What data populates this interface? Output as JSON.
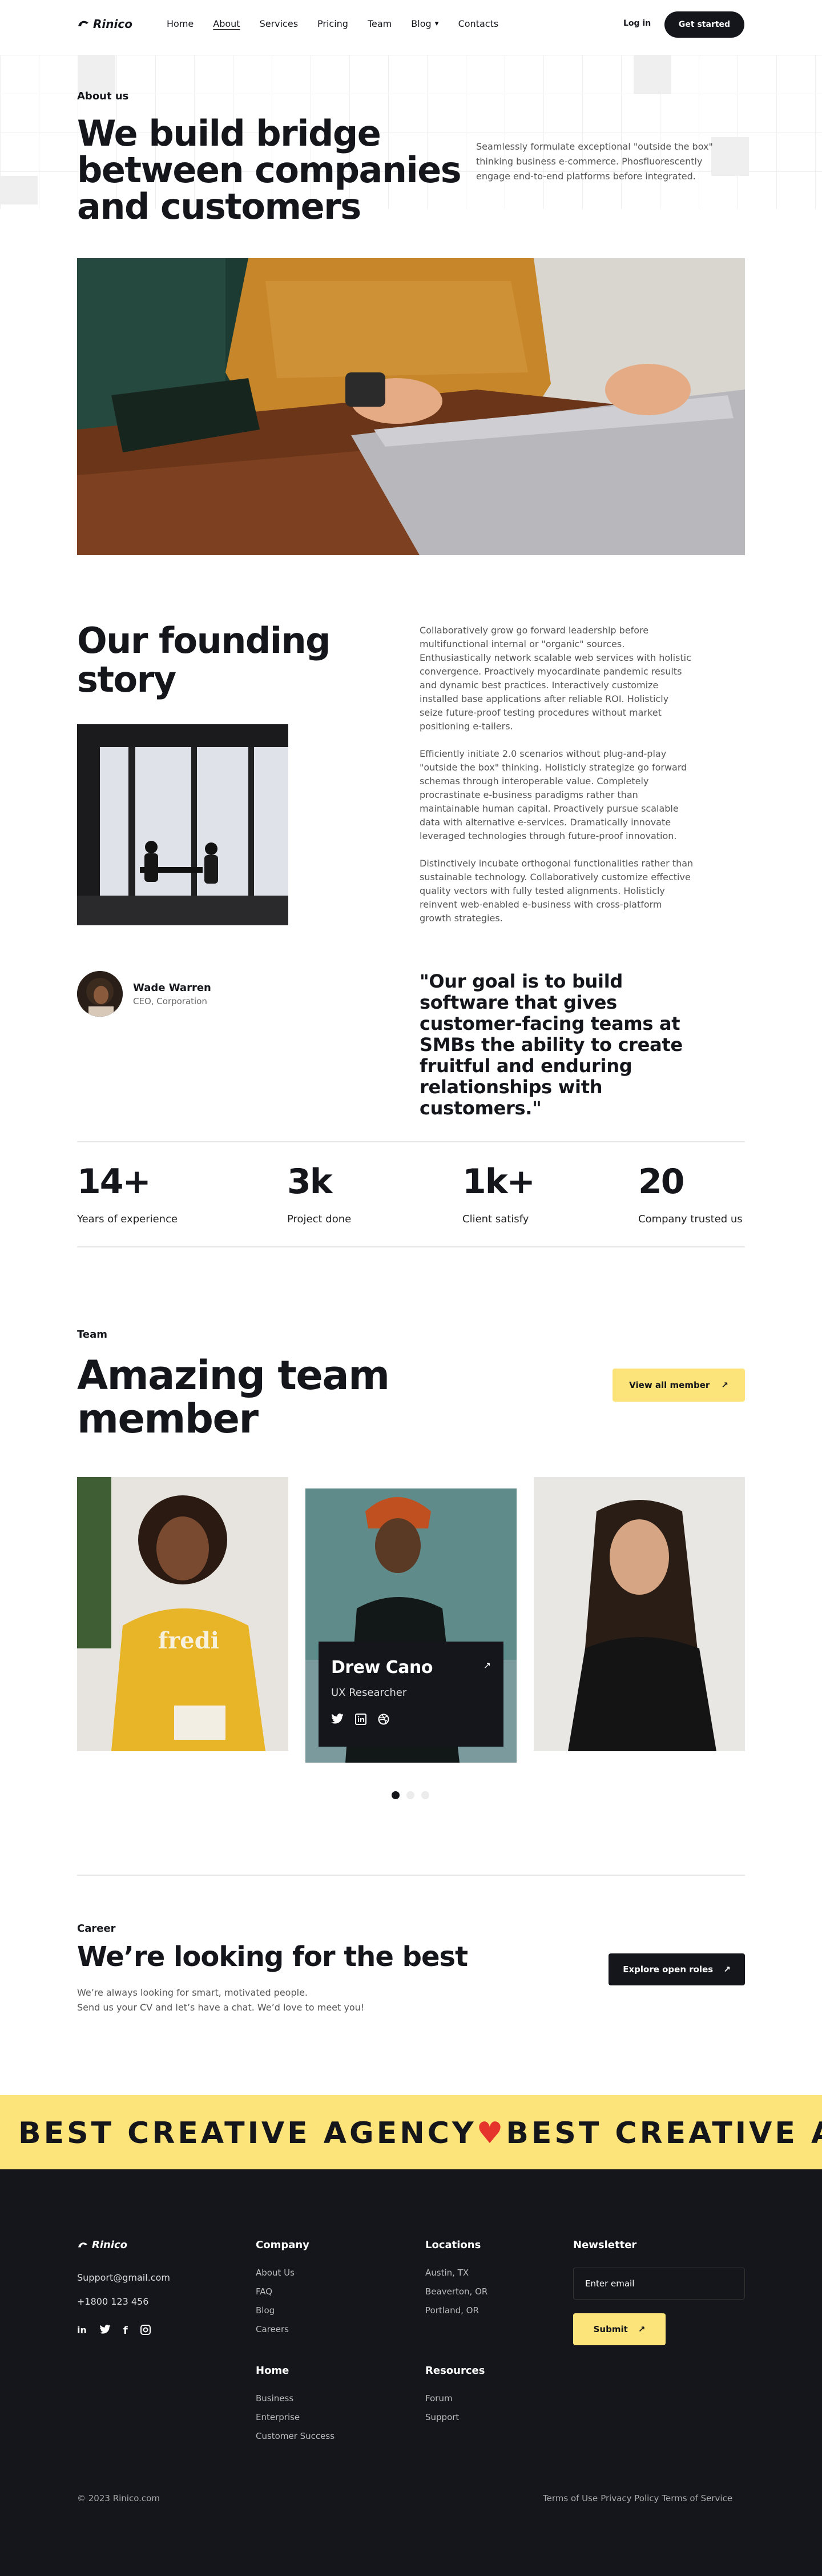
{
  "nav": {
    "logo": "Rinico",
    "items": [
      "Home",
      "About",
      "Services",
      "Pricing",
      "Team",
      "Blog",
      "Contacts"
    ],
    "active": "About",
    "login": "Log in",
    "cta": "Get started"
  },
  "about": {
    "eyebrow": "About us",
    "title": "We build bridge between companies and customers",
    "intro": "Seamlessly formulate exceptional \"outside the box\" thinking business e-commerce. Phosfluorescently engage end-to-end platforms before integrated."
  },
  "story": {
    "title": "Our founding story",
    "paragraphs": [
      "Collaboratively grow go forward leadership before multifunctional internal or \"organic\" sources. Enthusiastically network scalable web services with holistic convergence. Proactively myocardinate pandemic results and dynamic best practices. Interactively customize installed base applications after reliable ROI. Holisticly seize future-proof testing procedures without market positioning e-tailers.",
      "Efficiently initiate 2.0 scenarios without plug-and-play \"outside the box\" thinking. Holisticly strategize go forward schemas through interoperable value. Completely procrastinate e-business paradigms rather than maintainable human capital. Proactively pursue scalable data with alternative e-services. Dramatically innovate leveraged technologies through future-proof innovation.",
      "Distinctively incubate orthogonal functionalities rather than sustainable technology. Collaboratively customize effective quality vectors with fully tested alignments. Holisticly reinvent web-enabled e-business with cross-platform growth strategies."
    ],
    "person_name": "Wade Warren",
    "person_role": "CEO, Corporation",
    "quote": "\"Our goal is to build software that gives customer-facing teams at SMBs the ability to create fruitful and enduring relationships with customers.\""
  },
  "stats": [
    {
      "num": "14+",
      "label": "Years of experience"
    },
    {
      "num": "3k",
      "label": "Project done"
    },
    {
      "num": "1k+",
      "label": "Client satisfy"
    },
    {
      "num": "20",
      "label": "Company trusted us"
    }
  ],
  "team": {
    "eyebrow": "Team",
    "title": "Amazing team member",
    "view_all": "View all member",
    "featured_name": "Drew Cano",
    "featured_role": "UX Researcher",
    "sweater_text": "fredi"
  },
  "career": {
    "eyebrow": "Career",
    "title": "We’re looking for the best",
    "line1": "We’re always looking for smart, motivated people.",
    "line2": "Send us your CV and let’s have a chat. We’d love to meet you!",
    "cta": "Explore open roles"
  },
  "marquee": {
    "text_a": "BEST CREATIVE AGENCY",
    "text_b": "BEST CREATIVE AGEN"
  },
  "footer": {
    "logo": "Rinico",
    "email": "Support@gmail.com",
    "phone": "+1800 123 456",
    "company_head": "Company",
    "company_links": [
      "About Us",
      "FAQ",
      "Blog",
      "Careers"
    ],
    "locations_head": "Locations",
    "locations": [
      "Austin, TX",
      "Beaverton, OR",
      "Portland, OR"
    ],
    "newsletter_head": "Newsletter",
    "email_placeholder": "Enter email",
    "submit": "Submit",
    "home_head": "Home",
    "home_links": [
      "Business",
      "Enterprise",
      "Customer Success"
    ],
    "resources_head": "Resources",
    "resources_links": [
      "Forum",
      "Support"
    ],
    "copyright": "© 2023 Rinico.com",
    "terms_a": "Terms of Use",
    "terms_b": "Privacy Policy",
    "terms_c": "Terms of Service"
  },
  "colors": {
    "dark": "#14161c",
    "accent": "#fde47a"
  }
}
